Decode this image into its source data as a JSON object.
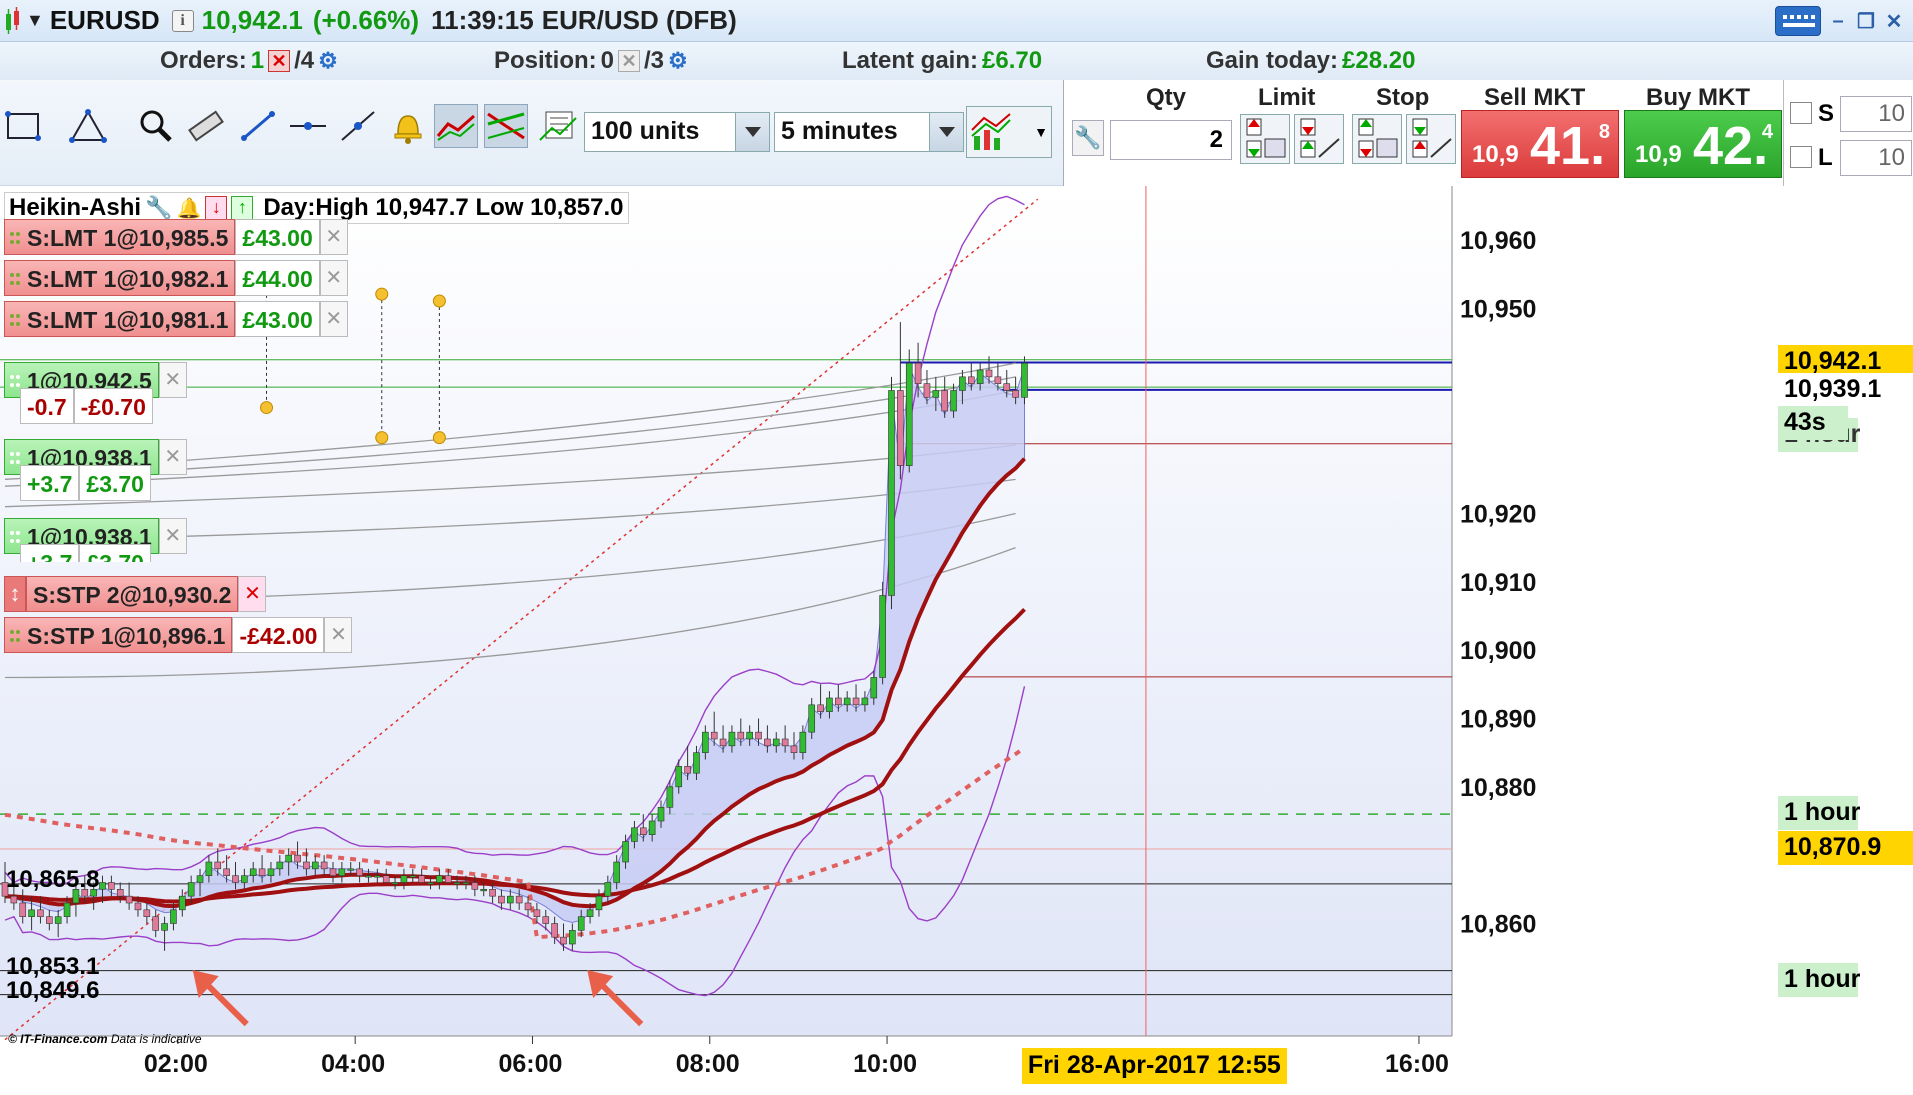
{
  "titlebar": {
    "symbol": "EURUSD",
    "price": "10,942.1",
    "change": "(+0.66%)",
    "time": "11:39:15",
    "pair": "EUR/USD (DFB)",
    "info_icon": "i"
  },
  "status": {
    "orders_label": "Orders:",
    "orders_count": "1",
    "orders_total": "/4",
    "position_label": "Position:",
    "position_count": "0",
    "position_total": "/3",
    "latent_label": "Latent gain:",
    "latent_value": "£6.70",
    "gain_label": "Gain today:",
    "gain_value": "£28.20"
  },
  "toolbar": {
    "units_value": "100 units",
    "timeframe_value": "5 minutes"
  },
  "ticket": {
    "qty_label": "Qty",
    "qty_value": "2",
    "limit_label": "Limit",
    "stop_label": "Stop",
    "sell_label": "Sell MKT",
    "buy_label": "Buy MKT",
    "sell_small": "10,9",
    "sell_big": "41.",
    "sell_sup": "8",
    "buy_small": "10,9",
    "buy_big": "42.",
    "buy_sup": "4"
  },
  "side": {
    "s_label": "S",
    "l_label": "L",
    "s_value": "10",
    "l_value": "10"
  },
  "chart_header": {
    "type": "Heikin-Ashi",
    "day_info": "Day:High 10,947.7 Low 10,857.0"
  },
  "orders": [
    {
      "label": "S:LMT 1@10,985.5",
      "pnl": "£43.00"
    },
    {
      "label": "S:LMT 1@10,982.1",
      "pnl": "£44.00"
    },
    {
      "label": "S:LMT 1@10,981.1",
      "pnl": "£43.00"
    }
  ],
  "positions": [
    {
      "label": "1@10,942.5",
      "pnl_pts": "-0.7",
      "pnl": "-£0.70"
    },
    {
      "label": "1@10,938.1",
      "pnl_pts": "+3.7",
      "pnl": "£3.70"
    },
    {
      "label": "1@10,938.1",
      "pnl_pts": "+3.7",
      "pnl": "£3.70"
    }
  ],
  "stops": [
    {
      "label": "S:STP 2@10,930.2"
    },
    {
      "label": "S:STP 1@10,896.1",
      "pnl": "-£42.00"
    }
  ],
  "left_prices": {
    "p1": "10,865.8",
    "p2": "10,853.1",
    "p3": "10,849.6"
  },
  "right_tags": {
    "last": "10,942.1",
    "prev": "10,939.1",
    "countdown": "43s",
    "under_countdown": "1 hour",
    "hour1": "1 hour",
    "level": "10,870.9",
    "hour2": "1 hour"
  },
  "watermark": "© IT-Finance.com",
  "watermark2": "Data is indicative",
  "date_tag": "Fri 28-Apr-2017 12:55",
  "chart_data": {
    "type": "candlestick",
    "instrument": "EURUSD",
    "ylim": [
      10845,
      10965
    ],
    "y_ticks": [
      10960,
      10950,
      10920,
      10910,
      10900,
      10890,
      10880,
      10860
    ],
    "y_tick_labels": [
      "10,960",
      "10,950",
      "10,920",
      "10,910",
      "10,900",
      "10,890",
      "10,880",
      "10,860"
    ],
    "x_ticks": [
      "02:00",
      "04:00",
      "06:00",
      "08:00",
      "10:00",
      "16:00"
    ],
    "x_tick_hours": [
      2,
      4,
      6,
      8,
      10,
      16
    ],
    "xlim_hours": [
      0.05,
      16.35
    ],
    "last_hour": 11.65,
    "cursor_hour": 12.92,
    "candles": [
      [
        0.05,
        10866,
        10869,
        10863,
        10864
      ],
      [
        0.15,
        10864,
        10866,
        10862,
        10863
      ],
      [
        0.25,
        10863,
        10865,
        10860,
        10861
      ],
      [
        0.35,
        10861,
        10864,
        10859,
        10862
      ],
      [
        0.45,
        10862,
        10864,
        10860,
        10861
      ],
      [
        0.55,
        10861,
        10862,
        10859,
        10860
      ],
      [
        0.65,
        10860,
        10862,
        10858,
        10861
      ],
      [
        0.75,
        10861,
        10864,
        10860,
        10863
      ],
      [
        0.85,
        10863,
        10866,
        10861,
        10865
      ],
      [
        0.95,
        10865,
        10867,
        10863,
        10864
      ],
      [
        1.05,
        10864,
        10866,
        10862,
        10865
      ],
      [
        1.15,
        10865,
        10867,
        10863,
        10866
      ],
      [
        1.25,
        10866,
        10867,
        10864,
        10865
      ],
      [
        1.35,
        10865,
        10866,
        10863,
        10864
      ],
      [
        1.45,
        10864,
        10866,
        10862,
        10863
      ],
      [
        1.55,
        10863,
        10864,
        10861,
        10862
      ],
      [
        1.65,
        10862,
        10863,
        10860,
        10861
      ],
      [
        1.75,
        10861,
        10862,
        10858,
        10859
      ],
      [
        1.85,
        10859,
        10861,
        10856,
        10860
      ],
      [
        1.95,
        10860,
        10863,
        10859,
        10862
      ],
      [
        2.05,
        10862,
        10865,
        10861,
        10864
      ],
      [
        2.15,
        10864,
        10867,
        10863,
        10866
      ],
      [
        2.25,
        10866,
        10868,
        10864,
        10867
      ],
      [
        2.35,
        10867,
        10870,
        10866,
        10869
      ],
      [
        2.45,
        10869,
        10871,
        10867,
        10868
      ],
      [
        2.55,
        10868,
        10870,
        10866,
        10867
      ],
      [
        2.65,
        10867,
        10869,
        10865,
        10866
      ],
      [
        2.75,
        10866,
        10868,
        10865,
        10867
      ],
      [
        2.85,
        10867,
        10869,
        10866,
        10868
      ],
      [
        2.95,
        10868,
        10870,
        10866,
        10867
      ],
      [
        3.05,
        10867,
        10869,
        10866,
        10868
      ],
      [
        3.15,
        10868,
        10870,
        10867,
        10869
      ],
      [
        3.25,
        10869,
        10871,
        10867,
        10870
      ],
      [
        3.35,
        10870,
        10872,
        10868,
        10869
      ],
      [
        3.45,
        10869,
        10871,
        10867,
        10868
      ],
      [
        3.55,
        10868,
        10870,
        10867,
        10869
      ],
      [
        3.65,
        10869,
        10870,
        10867,
        10868
      ],
      [
        3.75,
        10868,
        10869,
        10866,
        10867
      ],
      [
        3.85,
        10867,
        10869,
        10866,
        10868
      ],
      [
        3.95,
        10868,
        10869,
        10867,
        10868
      ],
      [
        4.05,
        10868,
        10869,
        10866,
        10867
      ],
      [
        4.15,
        10867,
        10868,
        10866,
        10867
      ],
      [
        4.25,
        10867,
        10868,
        10866,
        10867
      ],
      [
        4.35,
        10867,
        10868,
        10866,
        10866
      ],
      [
        4.45,
        10866,
        10867,
        10865,
        10866
      ],
      [
        4.55,
        10866,
        10868,
        10865,
        10867
      ],
      [
        4.65,
        10867,
        10868,
        10866,
        10867
      ],
      [
        4.75,
        10867,
        10868,
        10866,
        10866
      ],
      [
        4.85,
        10866,
        10867,
        10865,
        10866
      ],
      [
        4.95,
        10866,
        10868,
        10865,
        10867
      ],
      [
        5.05,
        10867,
        10868,
        10866,
        10866
      ],
      [
        5.15,
        10866,
        10867,
        10865,
        10866
      ],
      [
        5.25,
        10866,
        10867,
        10865,
        10866
      ],
      [
        5.35,
        10866,
        10867,
        10864,
        10865
      ],
      [
        5.45,
        10865,
        10866,
        10864,
        10865
      ],
      [
        5.55,
        10865,
        10866,
        10863,
        10864
      ],
      [
        5.65,
        10864,
        10865,
        10862,
        10863
      ],
      [
        5.75,
        10863,
        10865,
        10862,
        10864
      ],
      [
        5.85,
        10864,
        10865,
        10862,
        10863
      ],
      [
        5.95,
        10863,
        10864,
        10861,
        10862
      ],
      [
        6.05,
        10862,
        10863,
        10860,
        10861
      ],
      [
        6.15,
        10861,
        10862,
        10859,
        10860
      ],
      [
        6.25,
        10860,
        10861,
        10857,
        10858
      ],
      [
        6.35,
        10858,
        10860,
        10856,
        10857
      ],
      [
        6.45,
        10857,
        10860,
        10856,
        10859
      ],
      [
        6.55,
        10859,
        10862,
        10858,
        10861
      ],
      [
        6.65,
        10861,
        10863,
        10860,
        10862
      ],
      [
        6.75,
        10862,
        10865,
        10861,
        10864
      ],
      [
        6.85,
        10864,
        10867,
        10863,
        10866
      ],
      [
        6.95,
        10866,
        10870,
        10865,
        10869
      ],
      [
        7.05,
        10869,
        10873,
        10868,
        10872
      ],
      [
        7.15,
        10872,
        10875,
        10871,
        10874
      ],
      [
        7.25,
        10874,
        10876,
        10872,
        10873
      ],
      [
        7.35,
        10873,
        10876,
        10872,
        10875
      ],
      [
        7.45,
        10875,
        10878,
        10874,
        10877
      ],
      [
        7.55,
        10877,
        10881,
        10876,
        10880
      ],
      [
        7.65,
        10880,
        10884,
        10879,
        10883
      ],
      [
        7.75,
        10883,
        10886,
        10881,
        10882
      ],
      [
        7.85,
        10882,
        10886,
        10881,
        10885
      ],
      [
        7.95,
        10885,
        10889,
        10884,
        10888
      ],
      [
        8.05,
        10888,
        10891,
        10886,
        10887
      ],
      [
        8.15,
        10887,
        10889,
        10885,
        10886
      ],
      [
        8.25,
        10886,
        10889,
        10885,
        10888
      ],
      [
        8.35,
        10888,
        10890,
        10886,
        10887
      ],
      [
        8.45,
        10887,
        10889,
        10886,
        10888
      ],
      [
        8.55,
        10888,
        10890,
        10886,
        10887
      ],
      [
        8.65,
        10887,
        10889,
        10885,
        10886
      ],
      [
        8.75,
        10886,
        10888,
        10885,
        10887
      ],
      [
        8.85,
        10887,
        10889,
        10885,
        10886
      ],
      [
        8.95,
        10886,
        10888,
        10884,
        10885
      ],
      [
        9.05,
        10885,
        10889,
        10884,
        10888
      ],
      [
        9.15,
        10888,
        10893,
        10887,
        10892
      ],
      [
        9.25,
        10892,
        10895,
        10890,
        10891
      ],
      [
        9.35,
        10891,
        10894,
        10890,
        10893
      ],
      [
        9.45,
        10893,
        10895,
        10891,
        10892
      ],
      [
        9.55,
        10892,
        10894,
        10891,
        10893
      ],
      [
        9.65,
        10893,
        10895,
        10891,
        10892
      ],
      [
        9.75,
        10892,
        10894,
        10891,
        10893
      ],
      [
        9.85,
        10893,
        10897,
        10892,
        10896
      ],
      [
        9.95,
        10896,
        10910,
        10895,
        10908
      ],
      [
        10.05,
        10908,
        10940,
        10906,
        10938
      ],
      [
        10.15,
        10938,
        10948,
        10925,
        10927
      ],
      [
        10.25,
        10927,
        10944,
        10926,
        10942
      ],
      [
        10.35,
        10942,
        10945,
        10937,
        10939
      ],
      [
        10.45,
        10939,
        10941,
        10936,
        10937
      ],
      [
        10.55,
        10937,
        10940,
        10935,
        10938
      ],
      [
        10.65,
        10938,
        10940,
        10934,
        10935
      ],
      [
        10.75,
        10935,
        10939,
        10934,
        10938
      ],
      [
        10.85,
        10938,
        10941,
        10936,
        10940
      ],
      [
        10.95,
        10940,
        10942,
        10938,
        10939
      ],
      [
        11.05,
        10939,
        10942,
        10938,
        10941
      ],
      [
        11.15,
        10941,
        10943,
        10939,
        10940
      ],
      [
        11.25,
        10940,
        10942,
        10938,
        10939
      ],
      [
        11.35,
        10939,
        10941,
        10937,
        10938
      ],
      [
        11.45,
        10938,
        10940,
        10936,
        10937
      ],
      [
        11.55,
        10937,
        10943,
        10936,
        10942
      ]
    ]
  },
  "colors": {
    "up": "#33bb33",
    "down": "#e07a9a",
    "ma": "#a01010",
    "bollinger": "#9b3fc8",
    "band_fill": "#c7ccf5",
    "sell": "#db3b3b",
    "buy": "#2aa52a"
  }
}
